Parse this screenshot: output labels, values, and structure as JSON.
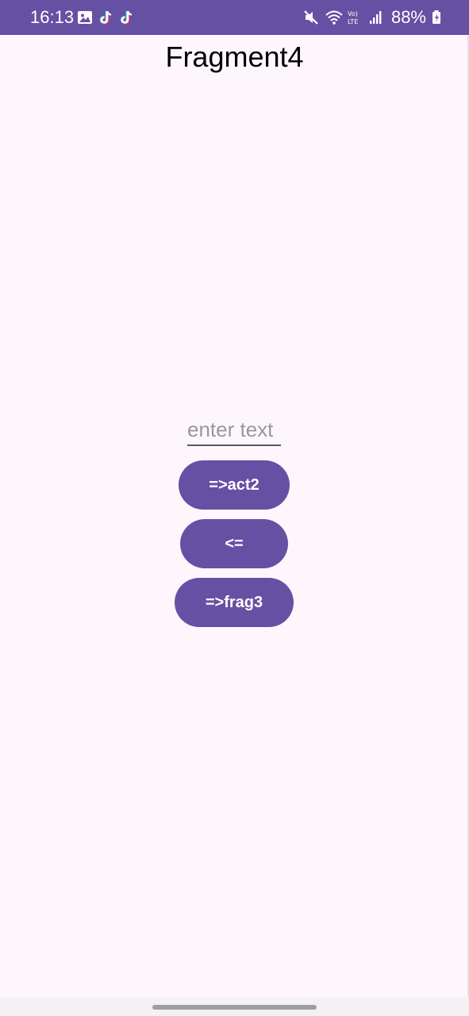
{
  "status_bar": {
    "time": "16:13",
    "left_icons": [
      "gallery-icon",
      "tiktok-icon",
      "tiktok-icon"
    ],
    "right_icons": [
      "mute-icon",
      "wifi-icon",
      "volte-icon",
      "signal-icon"
    ],
    "battery_percent": "88%",
    "background_color": "#6650A4"
  },
  "screen": {
    "title": "Fragment4",
    "background_color": "#FDF7FD"
  },
  "input": {
    "value": "",
    "placeholder": "enter text"
  },
  "buttons": {
    "to_act2": "=>act2",
    "back": "<=",
    "to_frag3": "=>frag3",
    "color": "#6650A4"
  }
}
